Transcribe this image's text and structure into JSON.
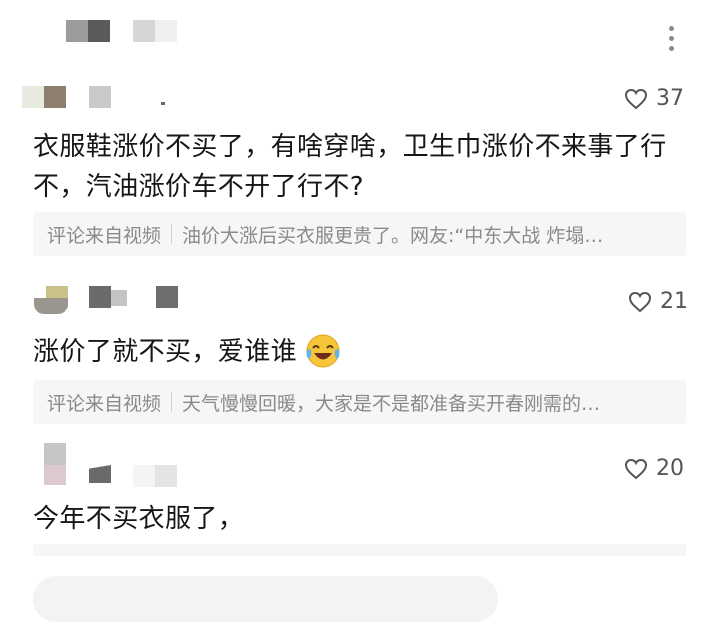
{
  "comments": [
    {
      "likes": "37",
      "text_lines": [
        "衣服鞋涨价不买了，有啥穿啥，卫生巾涨价不来事了行",
        "不，汽油涨价车不开了行不?"
      ],
      "ref_source": "评论来自视频",
      "ref_title": "油价大涨后买衣服更贵了。网友:“中东大战 炸塌…"
    },
    {
      "likes": "21",
      "text_lines": [
        "涨价了就不买，爱谁谁"
      ],
      "emoji": "crying-laughing-emoji",
      "ref_source": "评论来自视频",
      "ref_title": "天气慢慢回暖，大家是不是都准备买开春刚需的…"
    },
    {
      "likes": "20",
      "text_lines": [
        "今年不买衣服了，"
      ]
    }
  ],
  "icons": {
    "more": "more-vertical-icon",
    "like": "heart-outline-icon"
  },
  "colors": {
    "text": "#161616",
    "muted": "#8a8a8a",
    "ref_bg": "#f6f6f6"
  }
}
